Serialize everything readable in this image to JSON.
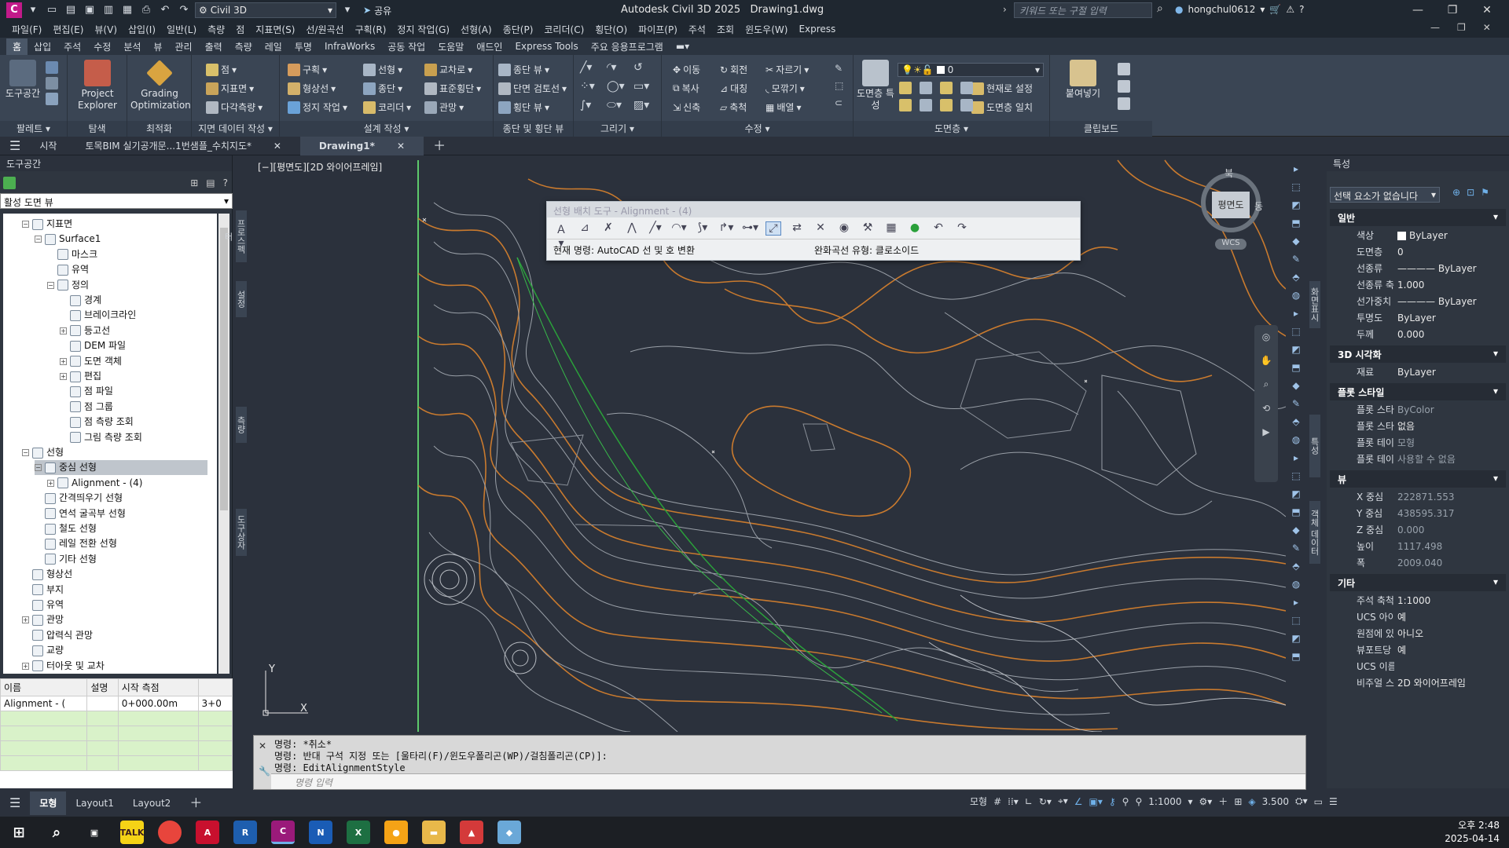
{
  "title": {
    "workspace": "Civil 3D",
    "share": "공유",
    "app": "Autodesk Civil 3D 2025",
    "doc": "Drawing1.dwg",
    "search_placeholder": "키워드 또는 구절 입력",
    "user": "hongchul0612"
  },
  "menu": [
    "파일(F)",
    "편집(E)",
    "뷰(V)",
    "삽입(I)",
    "일반(L)",
    "측량",
    "점",
    "지표면(S)",
    "선/원곡선",
    "구획(R)",
    "정지 작업(G)",
    "선형(A)",
    "종단(P)",
    "코리더(C)",
    "횡단(O)",
    "파이프(P)",
    "주석",
    "조회",
    "윈도우(W)",
    "Express"
  ],
  "ribbon_tabs": [
    "홈",
    "삽입",
    "주석",
    "수정",
    "분석",
    "뷰",
    "관리",
    "출력",
    "측량",
    "레일",
    "투명",
    "InfraWorks",
    "공동 작업",
    "도움말",
    "애드인",
    "Express Tools",
    "주요 응용프로그램"
  ],
  "ribbon": {
    "toolspace": "도구공간",
    "project_explorer": "Project Explorer",
    "grading_opt": "Grading Optimization",
    "palette": "팔레트",
    "explore": "탐색",
    "optimize": "최적화",
    "g1": [
      "점",
      "지표면",
      "다각측량"
    ],
    "g1_title": "지면 데이터 작성",
    "g2": [
      "구획",
      "형상선",
      "정지 작업"
    ],
    "g2b": [
      "선형",
      "종단",
      "코리더"
    ],
    "g2c": [
      "교차로",
      "표준횡단",
      "관망"
    ],
    "g2_title": "설계 작성",
    "g3": [
      "종단 뷰",
      "단면 검토선",
      "횡단 뷰"
    ],
    "g3_title": "종단 및 횡단 뷰",
    "g4_title": "그리기",
    "g5": [
      "이동",
      "복사",
      "신축"
    ],
    "g5b": [
      "회전",
      "대칭",
      "축척"
    ],
    "g5c": [
      "자르기",
      "모깎기",
      "배열"
    ],
    "g5_title": "수정",
    "layer_props": "도면층 특성",
    "layer_value": "0",
    "layer_set": "현재로 설정",
    "layer_match": "도면층 일치",
    "g6_title": "도면층",
    "paste": "붙여넣기",
    "g7_title": "클립보드"
  },
  "doc_tabs": [
    "시작",
    "토목BIM 실기공개문...1번샘플_수치지도*",
    "Drawing1*"
  ],
  "toolspace": {
    "title": "도구공간",
    "view": "활성 도면 뷰",
    "tree": [
      {
        "t": "지표면",
        "l": 1,
        "e": "−"
      },
      {
        "t": "Surface1",
        "l": 2,
        "e": "−"
      },
      {
        "t": "마스크",
        "l": 3
      },
      {
        "t": "유역",
        "l": 3
      },
      {
        "t": "정의",
        "l": 3,
        "e": "−"
      },
      {
        "t": "경계",
        "l": 4
      },
      {
        "t": "브레이크라인",
        "l": 4
      },
      {
        "t": "등고선",
        "l": 4,
        "e": "+"
      },
      {
        "t": "DEM 파일",
        "l": 4
      },
      {
        "t": "도면 객체",
        "l": 4,
        "e": "+"
      },
      {
        "t": "편집",
        "l": 4,
        "e": "+"
      },
      {
        "t": "점 파일",
        "l": 4
      },
      {
        "t": "점 그룹",
        "l": 4
      },
      {
        "t": "점 측량 조회",
        "l": 4
      },
      {
        "t": "그림 측량 조회",
        "l": 4
      },
      {
        "t": "선형",
        "l": 1,
        "e": "−"
      },
      {
        "t": "중심 선형",
        "l": 2,
        "e": "−",
        "sel": true
      },
      {
        "t": "Alignment - (4)",
        "l": 3,
        "e": "+"
      },
      {
        "t": "간격띄우기 선형",
        "l": 2
      },
      {
        "t": "연석 굴곡부 선형",
        "l": 2
      },
      {
        "t": "철도 선형",
        "l": 2
      },
      {
        "t": "레일 전환 선형",
        "l": 2
      },
      {
        "t": "기타 선형",
        "l": 2
      },
      {
        "t": "형상선",
        "l": 1
      },
      {
        "t": "부지",
        "l": 1
      },
      {
        "t": "유역",
        "l": 1
      },
      {
        "t": "관망",
        "l": 1,
        "e": "+"
      },
      {
        "t": "압력식 관망",
        "l": 1
      },
      {
        "t": "교량",
        "l": 1
      },
      {
        "t": "터아웃 및 교차",
        "l": 1,
        "e": "+"
      }
    ],
    "vtabs": [
      "프로스펙터",
      "설정",
      "측량",
      "도구상자"
    ],
    "list_headers": [
      "이름",
      "설명",
      "시작 측점"
    ],
    "list_row": [
      "Alignment - (",
      "",
      "0+000.00m",
      "3+0"
    ]
  },
  "canvas": {
    "view_label": "[−][평면도][2D 와이어프레임]",
    "cube_label": "평면도",
    "north": "북",
    "east": "동",
    "wcs": "WCS"
  },
  "align_tool": {
    "title": "선형 배치 도구 - Alignment - (4)",
    "current_cmd": "현재 명령: AutoCAD 선 및 호 변환",
    "spiral": "완화곡선 유형: 클로소이드"
  },
  "props": {
    "title": "특성",
    "selection": "선택 요소가 없습니다",
    "sections": [
      {
        "name": "일반",
        "rows": [
          [
            "색상",
            "ByLayer"
          ],
          [
            "도면층",
            "0"
          ],
          [
            "선종류",
            "———— ByLayer"
          ],
          [
            "선종류 축척",
            "1.000"
          ],
          [
            "선가중치",
            "———— ByLayer"
          ],
          [
            "투명도",
            "ByLayer"
          ],
          [
            "두께",
            "0.000"
          ]
        ]
      },
      {
        "name": "3D 시각화",
        "rows": [
          [
            "재료",
            "ByLayer"
          ]
        ]
      },
      {
        "name": "플롯 스타일",
        "rows": [
          [
            "플롯 스타일",
            "ByColor"
          ],
          [
            "플롯 스타...",
            "없음"
          ],
          [
            "플롯 테이...",
            "모형"
          ],
          [
            "플롯 테이...",
            "사용할 수 없음"
          ]
        ]
      },
      {
        "name": "뷰",
        "rows": [
          [
            "X 중심",
            "222871.553"
          ],
          [
            "Y 중심",
            "438595.317"
          ],
          [
            "Z 중심",
            "0.000"
          ],
          [
            "높이",
            "1117.498"
          ],
          [
            "폭",
            "2009.040"
          ]
        ]
      },
      {
        "name": "기타",
        "rows": [
          [
            "주석 축척",
            "1:1000"
          ],
          [
            "UCS 아이콘...",
            "예"
          ],
          [
            "원점에 있...",
            "아니오"
          ],
          [
            "뷰포트당 U...",
            "예"
          ],
          [
            "UCS 이름",
            ""
          ],
          [
            "비주얼 스...",
            "2D 와이어프레임"
          ]
        ]
      }
    ],
    "vtabs": [
      "특성",
      "화면표시",
      "객체 데이터"
    ]
  },
  "cmd": {
    "lines": [
      "명령: *취소*",
      "명령: 반대 구석 지정 또는 [울타리(F)/윈도우폴리곤(WP)/걸침폴리곤(CP)]:",
      "명령: EditAlignmentStyle"
    ],
    "placeholder": "명령 입력"
  },
  "layout_tabs": [
    "모형",
    "Layout1",
    "Layout2"
  ],
  "status": {
    "model": "모형",
    "scale": "1:1000",
    "value": "3.500"
  },
  "taskbar": {
    "time": "오후 2:48",
    "date": "2025-04-14"
  }
}
